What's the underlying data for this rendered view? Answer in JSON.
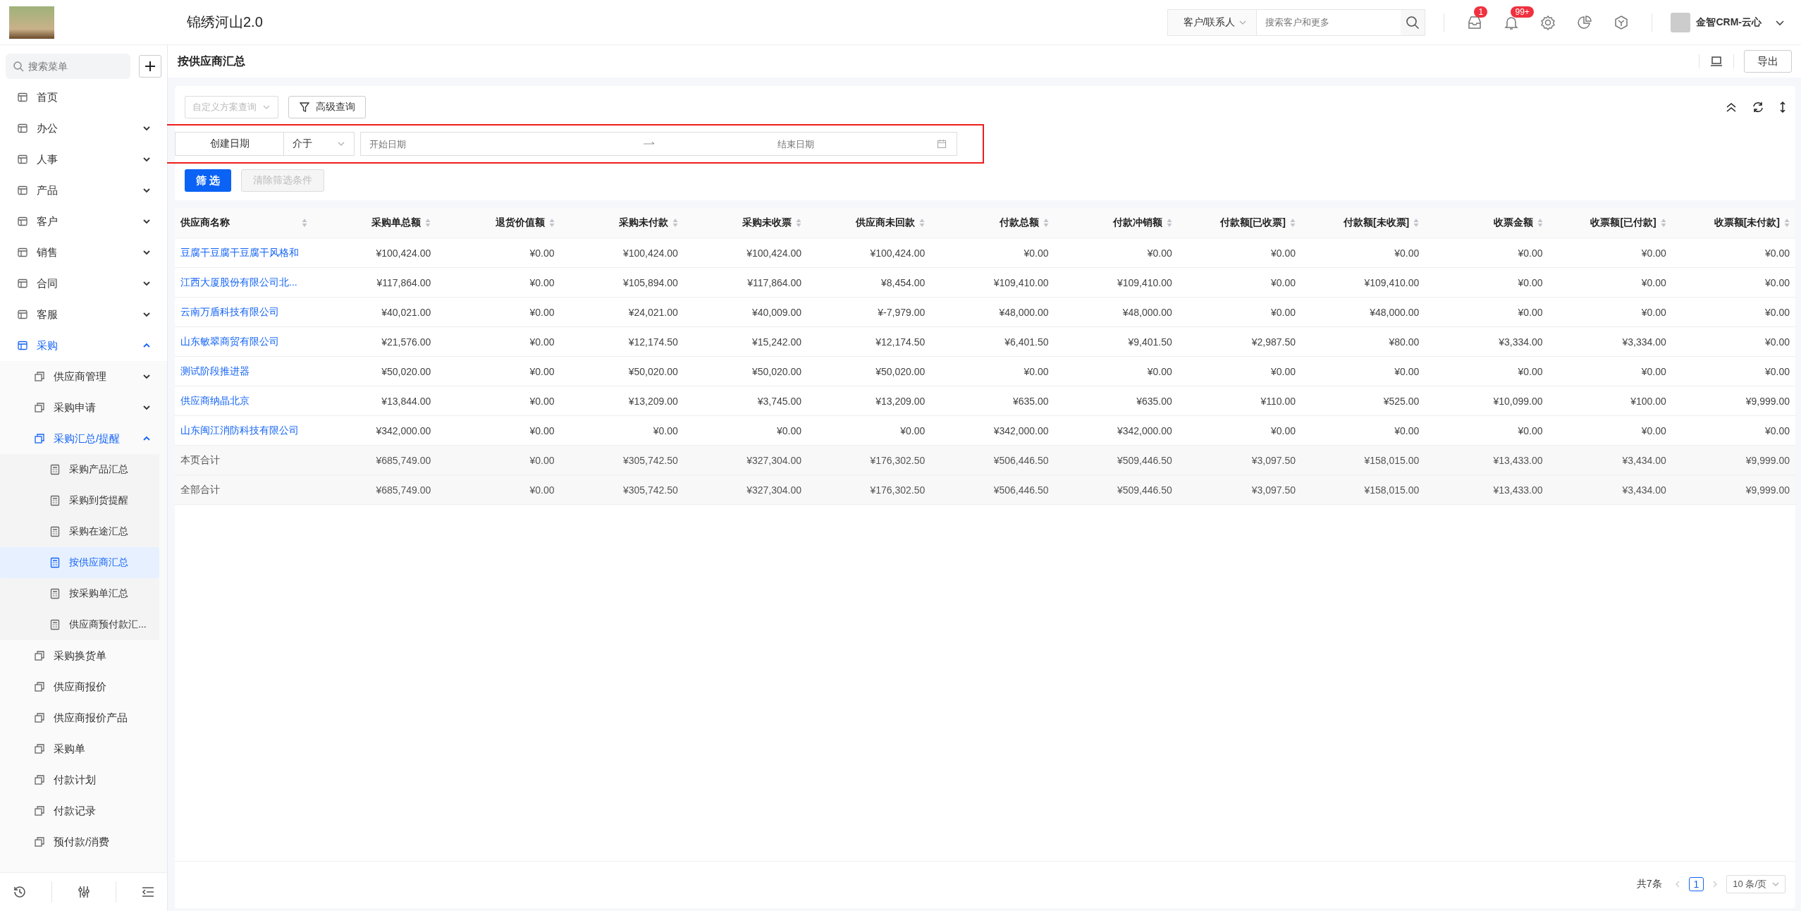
{
  "topbar": {
    "app_title": "锦绣河山2.0",
    "search_scope": "客户/联系人",
    "search_placeholder": "搜索客户和更多",
    "badges": [
      "1",
      "99+"
    ],
    "user_name": "金智CRM-云心"
  },
  "sidebar": {
    "search_placeholder": "搜索菜单",
    "items": [
      {
        "label": "首页",
        "selected": false
      },
      {
        "label": "办公",
        "selected": false,
        "expanded": false
      },
      {
        "label": "人事",
        "selected": false,
        "expanded": false
      },
      {
        "label": "产品",
        "selected": false,
        "expanded": false
      },
      {
        "label": "客户",
        "selected": false,
        "expanded": false
      },
      {
        "label": "销售",
        "selected": false,
        "expanded": false
      },
      {
        "label": "合同",
        "selected": false,
        "expanded": false
      },
      {
        "label": "客服",
        "selected": false,
        "expanded": false
      },
      {
        "label": "采购",
        "selected": false,
        "expanded": true,
        "children": [
          {
            "label": "供应商管理",
            "selected": false,
            "expanded": false
          },
          {
            "label": "采购申请",
            "selected": false,
            "expanded": false
          },
          {
            "label": "采购汇总/提醒",
            "selected": false,
            "expanded": true,
            "children": [
              {
                "label": "采购产品汇总",
                "selected": false
              },
              {
                "label": "采购到货提醒",
                "selected": false
              },
              {
                "label": "采购在途汇总",
                "selected": false
              },
              {
                "label": "按供应商汇总",
                "selected": true
              },
              {
                "label": "按采购单汇总",
                "selected": false
              },
              {
                "label": "供应商预付款汇...",
                "selected": false
              }
            ]
          },
          {
            "label": "采购换货单",
            "selected": false
          },
          {
            "label": "供应商报价",
            "selected": false
          },
          {
            "label": "供应商报价产品",
            "selected": false
          },
          {
            "label": "采购单",
            "selected": false
          },
          {
            "label": "付款计划",
            "selected": false
          },
          {
            "label": "付款记录",
            "selected": false
          },
          {
            "label": "预付款/消费",
            "selected": false
          }
        ]
      }
    ]
  },
  "page": {
    "title": "按供应商汇总",
    "export_button": "导出"
  },
  "filters": {
    "scheme_placeholder": "自定义方案查询",
    "advanced_button": "高级查询",
    "field": "创建日期",
    "operator": "介于",
    "start_placeholder": "开始日期",
    "end_placeholder": "结束日期",
    "highlighted": true,
    "filter_button": "筛 选",
    "clear_button": "清除筛选条件",
    "clear_disabled": true
  },
  "table": {
    "columns": [
      "供应商名称",
      "采购单总额",
      "退货价值额",
      "采购未付款",
      "采购未收票",
      "供应商未回款",
      "付款总额",
      "付款冲销额",
      "付款额[已收票]",
      "付款额[未收票]",
      "收票金额",
      "收票额[已付款]",
      "收票额[未付款]"
    ],
    "rows": [
      {
        "kind": "data",
        "cells": [
          "豆腐干豆腐干豆腐干风格和",
          "¥100,424.00",
          "¥0.00",
          "¥100,424.00",
          "¥100,424.00",
          "¥100,424.00",
          "¥0.00",
          "¥0.00",
          "¥0.00",
          "¥0.00",
          "¥0.00",
          "¥0.00",
          "¥0.00"
        ]
      },
      {
        "kind": "data",
        "cells": [
          "江西大厦股份有限公司北...",
          "¥117,864.00",
          "¥0.00",
          "¥105,894.00",
          "¥117,864.00",
          "¥8,454.00",
          "¥109,410.00",
          "¥109,410.00",
          "¥0.00",
          "¥109,410.00",
          "¥0.00",
          "¥0.00",
          "¥0.00"
        ]
      },
      {
        "kind": "data",
        "cells": [
          "云南万盾科技有限公司",
          "¥40,021.00",
          "¥0.00",
          "¥24,021.00",
          "¥40,009.00",
          "¥-7,979.00",
          "¥48,000.00",
          "¥48,000.00",
          "¥0.00",
          "¥48,000.00",
          "¥0.00",
          "¥0.00",
          "¥0.00"
        ]
      },
      {
        "kind": "data",
        "cells": [
          "山东敏翠商贸有限公司",
          "¥21,576.00",
          "¥0.00",
          "¥12,174.50",
          "¥15,242.00",
          "¥12,174.50",
          "¥6,401.50",
          "¥9,401.50",
          "¥2,987.50",
          "¥80.00",
          "¥3,334.00",
          "¥3,334.00",
          "¥0.00"
        ]
      },
      {
        "kind": "data",
        "cells": [
          "测试阶段推进器",
          "¥50,020.00",
          "¥0.00",
          "¥50,020.00",
          "¥50,020.00",
          "¥50,020.00",
          "¥0.00",
          "¥0.00",
          "¥0.00",
          "¥0.00",
          "¥0.00",
          "¥0.00",
          "¥0.00"
        ]
      },
      {
        "kind": "data",
        "cells": [
          "供应商纳晶北京",
          "¥13,844.00",
          "¥0.00",
          "¥13,209.00",
          "¥3,745.00",
          "¥13,209.00",
          "¥635.00",
          "¥635.00",
          "¥110.00",
          "¥525.00",
          "¥10,099.00",
          "¥100.00",
          "¥9,999.00"
        ]
      },
      {
        "kind": "data",
        "cells": [
          "山东闽江消防科技有限公司",
          "¥342,000.00",
          "¥0.00",
          "¥0.00",
          "¥0.00",
          "¥0.00",
          "¥342,000.00",
          "¥342,000.00",
          "¥0.00",
          "¥0.00",
          "¥0.00",
          "¥0.00",
          "¥0.00"
        ]
      },
      {
        "kind": "summary",
        "cells": [
          "本页合计",
          "¥685,749.00",
          "¥0.00",
          "¥305,742.50",
          "¥327,304.00",
          "¥176,302.50",
          "¥506,446.50",
          "¥509,446.50",
          "¥3,097.50",
          "¥158,015.00",
          "¥13,433.00",
          "¥3,434.00",
          "¥9,999.00"
        ]
      },
      {
        "kind": "summary",
        "cells": [
          "全部合计",
          "¥685,749.00",
          "¥0.00",
          "¥305,742.50",
          "¥327,304.00",
          "¥176,302.50",
          "¥506,446.50",
          "¥509,446.50",
          "¥3,097.50",
          "¥158,015.00",
          "¥13,433.00",
          "¥3,434.00",
          "¥9,999.00"
        ]
      }
    ]
  },
  "pagination": {
    "total": "共7条",
    "pages": [
      {
        "label": "1",
        "selected": true
      }
    ],
    "page_size": "10 条/页"
  }
}
